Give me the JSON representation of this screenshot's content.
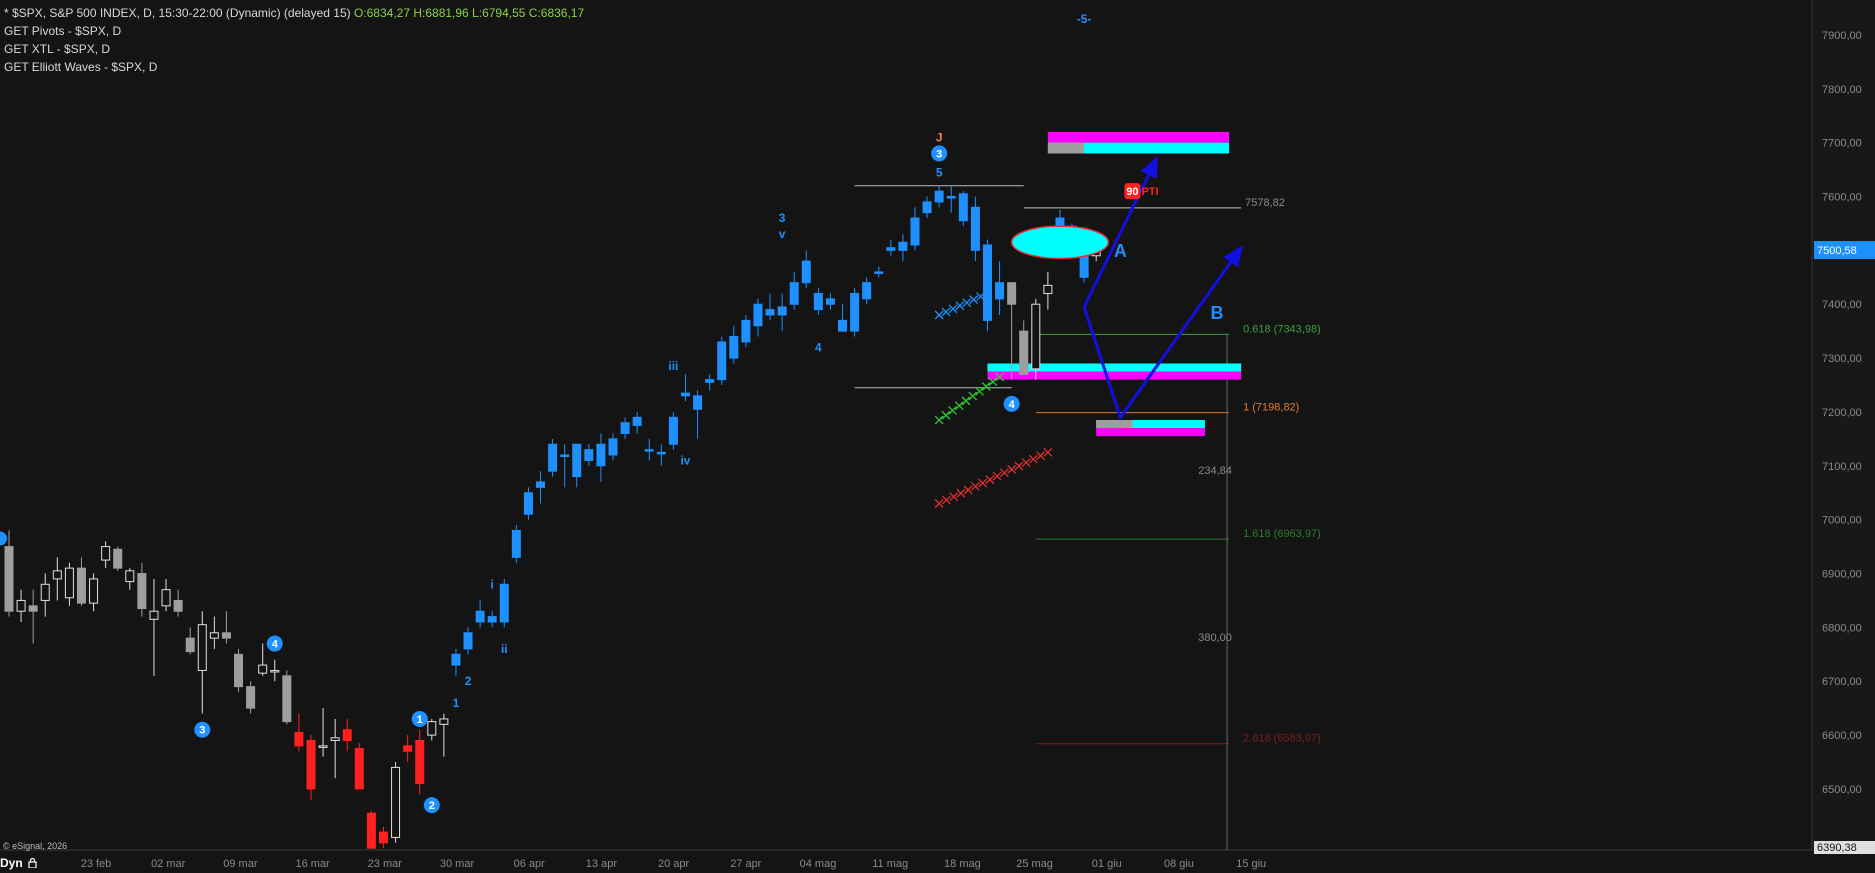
{
  "legend": {
    "title": "* $SPX, S&P 500 INDEX, D, 15:30-22:00 (Dynamic) (delayed 15)",
    "ohlc": "O:6834,27 H:6881,96 L:6794,55 C:6836,17",
    "studies": [
      "GET Pivots - $SPX, D",
      "GET XTL - $SPX, D",
      "GET Elliott Waves - $SPX, D"
    ]
  },
  "copyright": "© eSignal, 2026",
  "bottom_left": "Dyn",
  "colors": {
    "background": "#141414",
    "up": "#1e90ff",
    "down": "#9e9e9e",
    "red": "#ff2020",
    "white": "#e0e0e0",
    "cyan": "#00ffff",
    "magenta": "#ff00ff",
    "arrow": "#1010e0"
  },
  "chart_data": {
    "type": "candlestick",
    "ylim": [
      6390.38,
      7950
    ],
    "yticks": [
      "7900,00",
      "7800,00",
      "7700,00",
      "7600,00",
      "7500,00",
      "7400,00",
      "7300,00",
      "7200,00",
      "7100,00",
      "7000,00",
      "6900,00",
      "6800,00",
      "6700,00",
      "6600,00",
      "6500,00"
    ],
    "xticks": [
      "23 feb",
      "02 mar",
      "09 mar",
      "16 mar",
      "23 mar",
      "30 mar",
      "06 apr",
      "13 apr",
      "20 apr",
      "27 apr",
      "04 mag",
      "11 mag",
      "18 mag",
      "25 mag",
      "01 giu",
      "08 giu",
      "15 giu"
    ],
    "last_price": "7500,58",
    "axis_min_label": "6390,38",
    "candles": [
      {
        "o": 6950,
        "h": 6980,
        "l": 6820,
        "c": 6830,
        "s": "g"
      },
      {
        "o": 6830,
        "h": 6870,
        "l": 6810,
        "c": 6850,
        "s": "w"
      },
      {
        "o": 6840,
        "h": 6870,
        "l": 6770,
        "c": 6830,
        "s": "g"
      },
      {
        "o": 6850,
        "h": 6900,
        "l": 6820,
        "c": 6880,
        "s": "w"
      },
      {
        "o": 6890,
        "h": 6930,
        "l": 6850,
        "c": 6905,
        "s": "w"
      },
      {
        "o": 6855,
        "h": 6920,
        "l": 6840,
        "c": 6910,
        "s": "w"
      },
      {
        "o": 6910,
        "h": 6930,
        "l": 6840,
        "c": 6845,
        "s": "g"
      },
      {
        "o": 6845,
        "h": 6900,
        "l": 6830,
        "c": 6890,
        "s": "w"
      },
      {
        "o": 6925,
        "h": 6960,
        "l": 6910,
        "c": 6950,
        "s": "w"
      },
      {
        "o": 6945,
        "h": 6950,
        "l": 6905,
        "c": 6910,
        "s": "g"
      },
      {
        "o": 6885,
        "h": 6910,
        "l": 6870,
        "c": 6905,
        "s": "w"
      },
      {
        "o": 6900,
        "h": 6920,
        "l": 6820,
        "c": 6835,
        "s": "g"
      },
      {
        "o": 6830,
        "h": 6890,
        "l": 6710,
        "c": 6815,
        "s": "w"
      },
      {
        "o": 6870,
        "h": 6890,
        "l": 6830,
        "c": 6840,
        "s": "w"
      },
      {
        "o": 6850,
        "h": 6870,
        "l": 6820,
        "c": 6830,
        "s": "g"
      },
      {
        "o": 6780,
        "h": 6800,
        "l": 6750,
        "c": 6755,
        "s": "g"
      },
      {
        "o": 6805,
        "h": 6830,
        "l": 6640,
        "c": 6720,
        "s": "w"
      },
      {
        "o": 6780,
        "h": 6820,
        "l": 6760,
        "c": 6790,
        "s": "w"
      },
      {
        "o": 6790,
        "h": 6830,
        "l": 6770,
        "c": 6780,
        "s": "g"
      },
      {
        "o": 6750,
        "h": 6760,
        "l": 6680,
        "c": 6690,
        "s": "g"
      },
      {
        "o": 6690,
        "h": 6700,
        "l": 6640,
        "c": 6650,
        "s": "g"
      },
      {
        "o": 6730,
        "h": 6770,
        "l": 6710,
        "c": 6715,
        "s": "w"
      },
      {
        "o": 6720,
        "h": 6740,
        "l": 6700,
        "c": 6720,
        "s": "w"
      },
      {
        "o": 6710,
        "h": 6720,
        "l": 6620,
        "c": 6625,
        "s": "g"
      },
      {
        "o": 6605,
        "h": 6640,
        "l": 6570,
        "c": 6580,
        "s": "r"
      },
      {
        "o": 6590,
        "h": 6600,
        "l": 6480,
        "c": 6500,
        "s": "r"
      },
      {
        "o": 6580,
        "h": 6650,
        "l": 6560,
        "c": 6580,
        "s": "w"
      },
      {
        "o": 6595,
        "h": 6630,
        "l": 6520,
        "c": 6590,
        "s": "w"
      },
      {
        "o": 6610,
        "h": 6630,
        "l": 6570,
        "c": 6590,
        "s": "r"
      },
      {
        "o": 6575,
        "h": 6585,
        "l": 6500,
        "c": 6500,
        "s": "r"
      },
      {
        "o": 6455,
        "h": 6460,
        "l": 6390,
        "c": 6390,
        "s": "r"
      },
      {
        "o": 6420,
        "h": 6430,
        "l": 6390,
        "c": 6400,
        "s": "r"
      },
      {
        "o": 6410,
        "h": 6550,
        "l": 6400,
        "c": 6540,
        "s": "w"
      },
      {
        "o": 6570,
        "h": 6600,
        "l": 6550,
        "c": 6580,
        "s": "r"
      },
      {
        "o": 6590,
        "h": 6610,
        "l": 6490,
        "c": 6510,
        "s": "r"
      },
      {
        "o": 6600,
        "h": 6630,
        "l": 6590,
        "c": 6625,
        "s": "w"
      },
      {
        "o": 6620,
        "h": 6640,
        "l": 6560,
        "c": 6630,
        "s": "w"
      },
      {
        "o": 6730,
        "h": 6760,
        "l": 6710,
        "c": 6750,
        "s": "b"
      },
      {
        "o": 6760,
        "h": 6800,
        "l": 6750,
        "c": 6790,
        "s": "b"
      },
      {
        "o": 6810,
        "h": 6850,
        "l": 6800,
        "c": 6830,
        "s": "b"
      },
      {
        "o": 6820,
        "h": 6830,
        "l": 6800,
        "c": 6810,
        "s": "b"
      },
      {
        "o": 6810,
        "h": 6890,
        "l": 6800,
        "c": 6880,
        "s": "b"
      },
      {
        "o": 6930,
        "h": 6990,
        "l": 6920,
        "c": 6980,
        "s": "b"
      },
      {
        "o": 7010,
        "h": 7060,
        "l": 7000,
        "c": 7050,
        "s": "b"
      },
      {
        "o": 7060,
        "h": 7090,
        "l": 7030,
        "c": 7070,
        "s": "b"
      },
      {
        "o": 7090,
        "h": 7150,
        "l": 7080,
        "c": 7140,
        "s": "b"
      },
      {
        "o": 7120,
        "h": 7140,
        "l": 7060,
        "c": 7120,
        "s": "b"
      },
      {
        "o": 7140,
        "h": 7140,
        "l": 7060,
        "c": 7080,
        "s": "b"
      },
      {
        "o": 7110,
        "h": 7140,
        "l": 7100,
        "c": 7130,
        "s": "b"
      },
      {
        "o": 7100,
        "h": 7160,
        "l": 7070,
        "c": 7140,
        "s": "b"
      },
      {
        "o": 7120,
        "h": 7160,
        "l": 7110,
        "c": 7150,
        "s": "b"
      },
      {
        "o": 7160,
        "h": 7190,
        "l": 7150,
        "c": 7180,
        "s": "b"
      },
      {
        "o": 7175,
        "h": 7200,
        "l": 7160,
        "c": 7190,
        "s": "b"
      },
      {
        "o": 7130,
        "h": 7150,
        "l": 7110,
        "c": 7130,
        "s": "b"
      },
      {
        "o": 7125,
        "h": 7140,
        "l": 7100,
        "c": 7125,
        "s": "b"
      },
      {
        "o": 7140,
        "h": 7200,
        "l": 7130,
        "c": 7190,
        "s": "b"
      },
      {
        "o": 7230,
        "h": 7270,
        "l": 7220,
        "c": 7235,
        "s": "b"
      },
      {
        "o": 7230,
        "h": 7240,
        "l": 7150,
        "c": 7205,
        "s": "b"
      },
      {
        "o": 7255,
        "h": 7270,
        "l": 7240,
        "c": 7260,
        "s": "b"
      },
      {
        "o": 7260,
        "h": 7340,
        "l": 7250,
        "c": 7330,
        "s": "b"
      },
      {
        "o": 7300,
        "h": 7360,
        "l": 7290,
        "c": 7340,
        "s": "b"
      },
      {
        "o": 7330,
        "h": 7380,
        "l": 7320,
        "c": 7370,
        "s": "b"
      },
      {
        "o": 7360,
        "h": 7410,
        "l": 7340,
        "c": 7400,
        "s": "b"
      },
      {
        "o": 7390,
        "h": 7420,
        "l": 7370,
        "c": 7380,
        "s": "b"
      },
      {
        "o": 7380,
        "h": 7420,
        "l": 7350,
        "c": 7395,
        "s": "b"
      },
      {
        "o": 7400,
        "h": 7460,
        "l": 7390,
        "c": 7440,
        "s": "b"
      },
      {
        "o": 7440,
        "h": 7500,
        "l": 7430,
        "c": 7480,
        "s": "b"
      },
      {
        "o": 7420,
        "h": 7430,
        "l": 7380,
        "c": 7390,
        "s": "b"
      },
      {
        "o": 7410,
        "h": 7420,
        "l": 7390,
        "c": 7400,
        "s": "b"
      },
      {
        "o": 7370,
        "h": 7400,
        "l": 7350,
        "c": 7350,
        "s": "b"
      },
      {
        "o": 7350,
        "h": 7430,
        "l": 7340,
        "c": 7420,
        "s": "b"
      },
      {
        "o": 7410,
        "h": 7450,
        "l": 7400,
        "c": 7440,
        "s": "b"
      },
      {
        "o": 7460,
        "h": 7470,
        "l": 7450,
        "c": 7460,
        "s": "b"
      },
      {
        "o": 7500,
        "h": 7520,
        "l": 7490,
        "c": 7505,
        "s": "b"
      },
      {
        "o": 7500,
        "h": 7530,
        "l": 7480,
        "c": 7515,
        "s": "b"
      },
      {
        "o": 7510,
        "h": 7580,
        "l": 7500,
        "c": 7560,
        "s": "b"
      },
      {
        "o": 7570,
        "h": 7600,
        "l": 7560,
        "c": 7590,
        "s": "b"
      },
      {
        "o": 7590,
        "h": 7620,
        "l": 7580,
        "c": 7610,
        "s": "b"
      },
      {
        "o": 7600,
        "h": 7620,
        "l": 7570,
        "c": 7600,
        "s": "b"
      },
      {
        "o": 7605,
        "h": 7610,
        "l": 7545,
        "c": 7555,
        "s": "b"
      },
      {
        "o": 7580,
        "h": 7600,
        "l": 7480,
        "c": 7500,
        "s": "b"
      },
      {
        "o": 7510,
        "h": 7520,
        "l": 7350,
        "c": 7370,
        "s": "b"
      },
      {
        "o": 7410,
        "h": 7480,
        "l": 7380,
        "c": 7440,
        "s": "b"
      },
      {
        "o": 7440,
        "h": 7440,
        "l": 7260,
        "c": 7400,
        "s": "g"
      },
      {
        "o": 7350,
        "h": 7370,
        "l": 7270,
        "c": 7270,
        "s": "g"
      },
      {
        "o": 7280,
        "h": 7410,
        "l": 7260,
        "c": 7400,
        "s": "w"
      },
      {
        "o": 7420,
        "h": 7460,
        "l": 7390,
        "c": 7435,
        "s": "w"
      },
      {
        "o": 7560,
        "h": 7575,
        "l": 7520,
        "c": 7540,
        "s": "b"
      },
      {
        "o": 7545,
        "h": 7550,
        "l": 7510,
        "c": 7515,
        "s": "b"
      },
      {
        "o": 7530,
        "h": 7540,
        "l": 7440,
        "c": 7450,
        "s": "b"
      },
      {
        "o": 7500,
        "h": 7510,
        "l": 7480,
        "c": 7490,
        "s": "w"
      }
    ],
    "wave_labels": [
      {
        "text": "J",
        "i": 77,
        "y": 7710,
        "c": "#ff7a3a",
        "circle": false
      },
      {
        "text": "3",
        "i": 77,
        "y": 7680,
        "c": "#1e90ff",
        "circle": true
      },
      {
        "text": "5",
        "i": 77,
        "y": 7645,
        "c": "#1e90ff",
        "circle": false
      },
      {
        "text": "3",
        "i": 64,
        "y": 7560,
        "c": "#1e90ff",
        "circle": false
      },
      {
        "text": "v",
        "i": 64,
        "y": 7530,
        "c": "#1e90ff",
        "circle": false
      },
      {
        "text": "4",
        "i": 67,
        "y": 7320,
        "c": "#1e90ff",
        "circle": false
      },
      {
        "text": "iii",
        "i": 55,
        "y": 7285,
        "c": "#1e90ff",
        "circle": false
      },
      {
        "text": "iv",
        "i": 56,
        "y": 7110,
        "c": "#1e90ff",
        "circle": false
      },
      {
        "text": "i",
        "i": 40,
        "y": 6880,
        "c": "#1e90ff",
        "circle": false
      },
      {
        "text": "ii",
        "i": 41,
        "y": 6760,
        "c": "#1e90ff",
        "circle": false
      },
      {
        "text": "2",
        "i": 38,
        "y": 6700,
        "c": "#1e90ff",
        "circle": false
      },
      {
        "text": "1",
        "i": 37,
        "y": 6660,
        "c": "#1e90ff",
        "circle": false
      },
      {
        "text": "1",
        "i": 34,
        "y": 6630,
        "c": "#1e90ff",
        "circle": true
      },
      {
        "text": "2",
        "i": 35,
        "y": 6470,
        "c": "#1e90ff",
        "circle": true
      },
      {
        "text": "3",
        "i": 16,
        "y": 6610,
        "c": "#1e90ff",
        "circle": true
      },
      {
        "text": "4",
        "i": 22,
        "y": 6770,
        "c": "#1e90ff",
        "circle": true
      },
      {
        "text": "4",
        "i": 83,
        "y": 7215,
        "c": "#1e90ff",
        "circle": true
      },
      {
        "text": "A",
        "i": 92,
        "y": 7495,
        "c": "#1e90ff",
        "circle": false
      },
      {
        "text": "B",
        "i": 100,
        "y": 7380,
        "c": "#1e90ff",
        "circle": false
      },
      {
        "text": "-5-",
        "i": 89,
        "y": 7930,
        "c": "#1e90ff",
        "circle": false
      }
    ],
    "pivot_lines": [
      {
        "y": 7620,
        "i0": 70,
        "i1": 84,
        "c": "#bbbbbb"
      },
      {
        "y": 7245,
        "i0": 70,
        "i1": 83,
        "c": "#bbbbbb"
      },
      {
        "y": 7578.82,
        "i0": 84,
        "i1": 102,
        "c": "#bbbbbb"
      }
    ],
    "fib_levels": [
      {
        "label": "0.618 (7343,98)",
        "y": 7343.98,
        "c": "#3da03d"
      },
      {
        "label": "1 (7198,82)",
        "y": 7198.82,
        "c": "#e07a30"
      },
      {
        "label": "1.618 (6963,97)",
        "y": 6963.97,
        "c": "#2e7a2e"
      },
      {
        "label": "2.618 (6583,97)",
        "y": 6583.97,
        "c": "#7a1e1e"
      }
    ],
    "pivot_price_label": "7578,82",
    "distance_labels": [
      {
        "text": "234,84",
        "y": 7085
      },
      {
        "text": "380,00",
        "y": 6775
      }
    ],
    "zones": [
      {
        "i0": 86,
        "i1": 101,
        "y0": 7720,
        "y1": 7700,
        "c": "#ff00ff"
      },
      {
        "i0": 86,
        "i1": 101,
        "y0": 7700,
        "y1": 7680,
        "c": "#00ffff"
      },
      {
        "i0": 86,
        "i1": 89,
        "y0": 7700,
        "y1": 7680,
        "c": "#9e9e9e"
      },
      {
        "i0": 81,
        "i1": 102,
        "y0": 7290,
        "y1": 7275,
        "c": "#00ffff"
      },
      {
        "i0": 81,
        "i1": 102,
        "y0": 7275,
        "y1": 7260,
        "c": "#ff00ff"
      },
      {
        "i0": 90,
        "i1": 99,
        "y0": 7185,
        "y1": 7170,
        "c": "#00ffff"
      },
      {
        "i0": 90,
        "i1": 99,
        "y0": 7170,
        "y1": 7155,
        "c": "#ff00ff"
      },
      {
        "i0": 90,
        "i1": 93,
        "y0": 7185,
        "y1": 7170,
        "c": "#9e9e9e"
      }
    ],
    "ellipse": {
      "i0": 83,
      "i1": 91,
      "y": 7515,
      "dy": 30
    },
    "arrows": [
      [
        [
          89,
          7395
        ],
        [
          95,
          7670
        ]
      ],
      [
        [
          89,
          7395
        ],
        [
          92,
          7190
        ],
        [
          102,
          7505
        ]
      ]
    ],
    "badge": {
      "text": "90",
      "suffix": "PTI",
      "i": 93,
      "y": 7610
    },
    "x_markers": [
      {
        "i0": 77,
        "i1": 81,
        "y0": 7380,
        "y1": 7420,
        "c": "#1e90ff"
      },
      {
        "i0": 77,
        "i1": 82,
        "y0": 7185,
        "y1": 7265,
        "c": "#32c832"
      },
      {
        "i0": 77,
        "i1": 86,
        "y0": 7030,
        "y1": 7125,
        "c": "#e03030"
      }
    ]
  }
}
